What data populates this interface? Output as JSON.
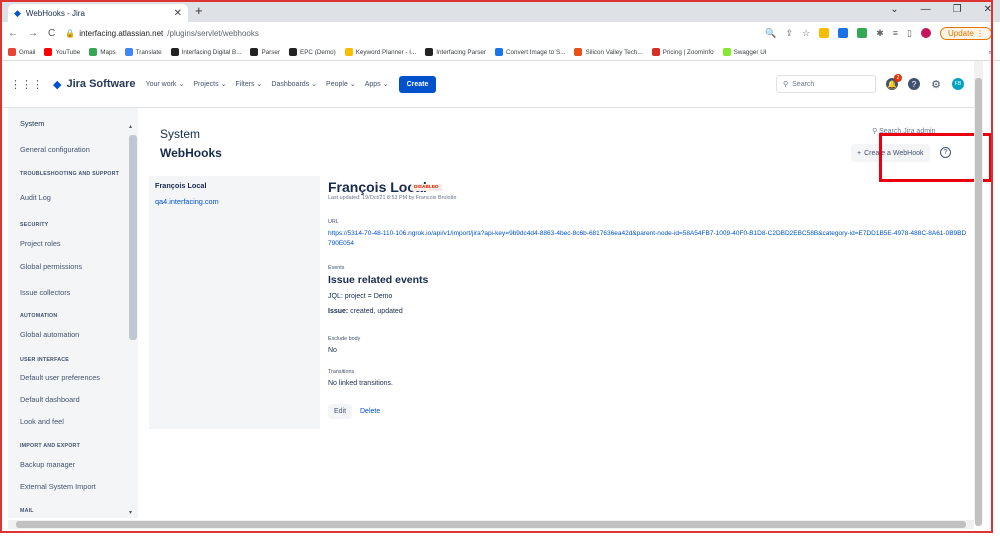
{
  "browser": {
    "tab_title": "WebHooks - Jira",
    "new_tab": "+",
    "url_domain": "interfacing.atlassian.net",
    "url_path": "/plugins/servlet/webhooks",
    "update_label": "Update",
    "bookmarks": [
      {
        "label": "Gmail",
        "color": "#ea4335"
      },
      {
        "label": "YouTube",
        "color": "#ff0000"
      },
      {
        "label": "Maps",
        "color": "#34a853"
      },
      {
        "label": "Translate",
        "color": "#4285f4"
      },
      {
        "label": "Interfacing Digital B...",
        "color": "#222222"
      },
      {
        "label": "Parser",
        "color": "#222222"
      },
      {
        "label": "EPC (Demo)",
        "color": "#222222"
      },
      {
        "label": "Keyword Planner - I...",
        "color": "#fbbc04"
      },
      {
        "label": "Interfacing Parser",
        "color": "#222222"
      },
      {
        "label": "Convert Image to S...",
        "color": "#1a73e8"
      },
      {
        "label": "Silicon Valley Tech...",
        "color": "#e94e1b"
      },
      {
        "label": "Pricing | ZoomInfo",
        "color": "#d93025"
      },
      {
        "label": "Swagger UI",
        "color": "#85ea2d"
      }
    ],
    "more": "»"
  },
  "jira_nav": {
    "product": "Jira Software",
    "items": [
      "Your work",
      "Projects",
      "Filters",
      "Dashboards",
      "People",
      "Apps"
    ],
    "create": "Create",
    "search_placeholder": "Search",
    "notification_count": "2",
    "avatar_initials": "FB"
  },
  "sidebar": {
    "top": "System",
    "general": "General configuration",
    "sec1": "TROUBLESHOOTING AND SUPPORT",
    "audit": "Audit Log",
    "sec2": "SECURITY",
    "project_roles": "Project roles",
    "global_permissions": "Global permissions",
    "issue_collectors": "Issue collectors",
    "sec3": "AUTOMATION",
    "global_automation": "Global automation",
    "sec4": "USER INTERFACE",
    "default_prefs": "Default user preferences",
    "default_dashboard": "Default dashboard",
    "look_feel": "Look and feel",
    "sec5": "IMPORT AND EXPORT",
    "backup": "Backup manager",
    "external_import": "External System Import",
    "sec6": "MAIL"
  },
  "main": {
    "crumb": "System",
    "title": "WebHooks",
    "search_admin": "Search Jira admin",
    "create_webhook": "Create a WebHook",
    "webhook_name": "François Local",
    "webhook_url": "qa4.interfacing.com",
    "detail_title": "François Local",
    "status": "DISABLED",
    "last_updated": "Last updated: 19/Oct/21 8:53 PM by Francois Brulotte",
    "url_label": "URL",
    "url_value": "https://5314-70-48-110-106.ngrok.io/api/v1/import/jira?api-key=9b9dc4d4-8863-4bec-8c6b-6817636ea42d&parent-node-id=58A54FB7-1009-40F0-B1D8-C2DBD2EBC58B&category-id=E7DD1B5E-4978-488C-8A61-0B9BD790E054",
    "events_label": "Events",
    "events_title": "Issue related events",
    "jql": "JQL: project = Demo",
    "issue_bold": "Issue:",
    "issue_events": " created, updated",
    "exclude_label": "Exclude body",
    "exclude_value": "No",
    "transitions_label": "Transitions",
    "transitions_value": "No linked transitions.",
    "edit": "Edit",
    "delete": "Delete"
  }
}
